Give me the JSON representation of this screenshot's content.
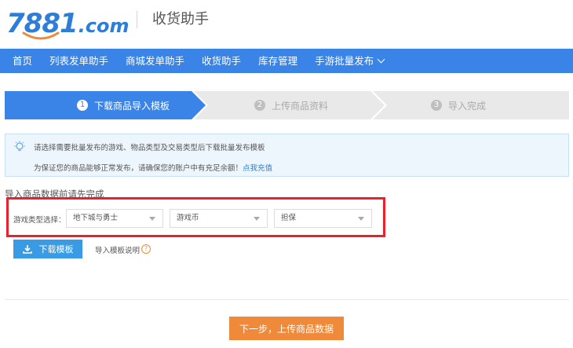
{
  "header": {
    "logo_main": "7881",
    "logo_suffix": ".com",
    "title": "收货助手"
  },
  "nav": {
    "items": [
      {
        "label": "首页"
      },
      {
        "label": "列表发单助手"
      },
      {
        "label": "商城发单助手"
      },
      {
        "label": "收货助手"
      },
      {
        "label": "库存管理"
      },
      {
        "label": "手游批量发布"
      }
    ]
  },
  "steps": [
    {
      "num": "1",
      "label": "下载商品导入模板",
      "state": "active"
    },
    {
      "num": "2",
      "label": "上传商品资料",
      "state": "inactive"
    },
    {
      "num": "3",
      "label": "导入完成",
      "state": "inactive"
    }
  ],
  "notice": {
    "line1": "请选择需要批量发布的游戏、物品类型及交易类型后下载批量发布模板",
    "line2": "为保证您的商品能够正常发布，请确保您的账户中有充足余额！",
    "link": "点我充值"
  },
  "import_label": "导入商品数据前请先完成",
  "selection": {
    "label": "游戏类型选择：",
    "game": "地下城与勇士",
    "item_type": "游戏币",
    "trade_type": "担保"
  },
  "actions": {
    "download_label": "下载模板",
    "help_label": "导入模板说明",
    "help_icon": "?",
    "next_label": "下一步，上传商品数据"
  },
  "colors": {
    "brand_blue": "#3a84e8",
    "accent_orange": "#f08a3b",
    "highlight_red": "#e8212a"
  }
}
